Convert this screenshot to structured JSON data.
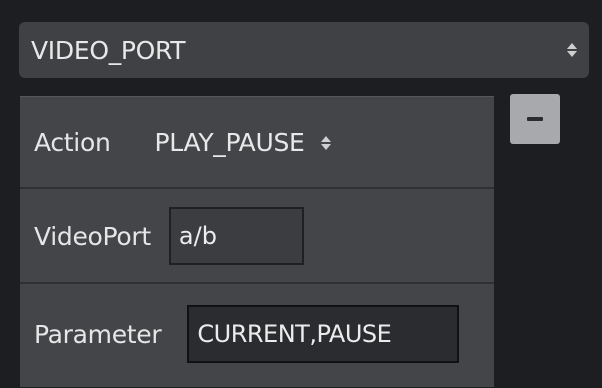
{
  "top_select": {
    "value": "VIDEO_PORT",
    "icon": "updown-arrows-icon"
  },
  "action_row": {
    "label": "Action",
    "value": "PLAY_PAUSE",
    "icon": "updown-arrows-icon"
  },
  "videoport_row": {
    "label": "VideoPort",
    "value": "a/b"
  },
  "parameter_row": {
    "label": "Parameter",
    "value": "CURRENT,PAUSE"
  },
  "remove_button": {
    "icon": "minus-icon"
  }
}
